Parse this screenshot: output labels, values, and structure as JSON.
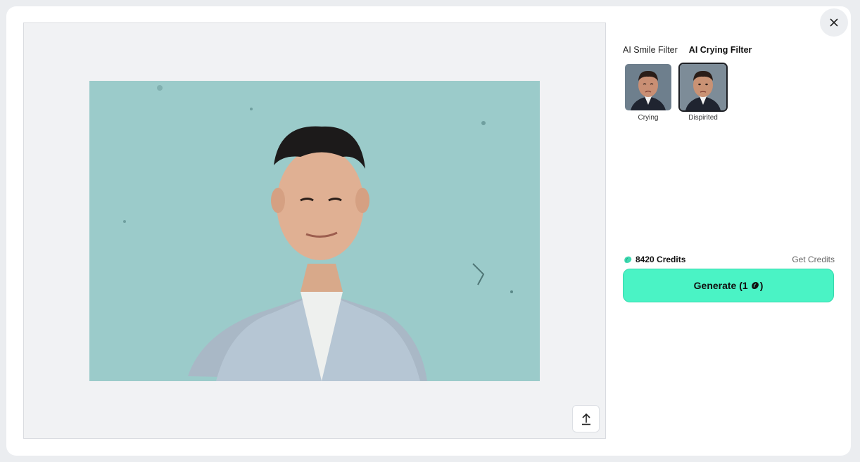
{
  "filter_tabs": [
    {
      "label": "AI Smile Filter",
      "active": false
    },
    {
      "label": "AI Crying Filter",
      "active": true
    }
  ],
  "styles": [
    {
      "label": "Crying",
      "selected": false
    },
    {
      "label": "Dispirited",
      "selected": true
    }
  ],
  "credits": {
    "amount_label": "8420 Credits",
    "get_label": "Get Credits",
    "icon": "credit-gem-icon"
  },
  "generate": {
    "label_prefix": "Generate (1",
    "label_suffix": ")",
    "icon": "credit-gem-icon"
  },
  "icons": {
    "close": "close-icon",
    "upload": "upload-icon"
  },
  "colors": {
    "accent": "#4af3c5",
    "modal_bg": "#ffffff",
    "preview_bg": "#f1f2f4",
    "photo_wall": "#8fc2c3"
  }
}
